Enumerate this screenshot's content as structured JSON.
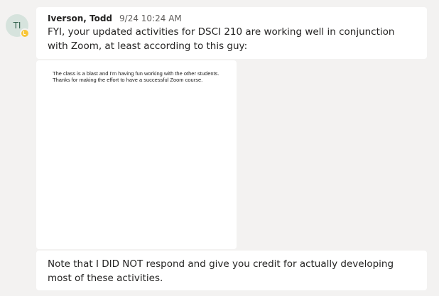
{
  "message": {
    "avatar_initials": "TI",
    "author": "Iverson, Todd",
    "timestamp": "9/24 10:24 AM",
    "text": "FYI, your updated activities for DSCI 210 are working well in conjunction with Zoom, at least according to this guy:"
  },
  "attachment": {
    "quoted_text": "The class is a blast and I'm having fun working with the other students. Thanks for making the effort to have a successful Zoom course."
  },
  "reply": {
    "text": "Note that I DID NOT respond and give you credit for actually developing most of these activities."
  },
  "colors": {
    "background": "#f3f2f1",
    "bubble": "#ffffff",
    "presence_away": "#f8c638",
    "avatar_bg": "#d6e3dd"
  },
  "icons": {
    "presence": "away-clock-icon"
  }
}
